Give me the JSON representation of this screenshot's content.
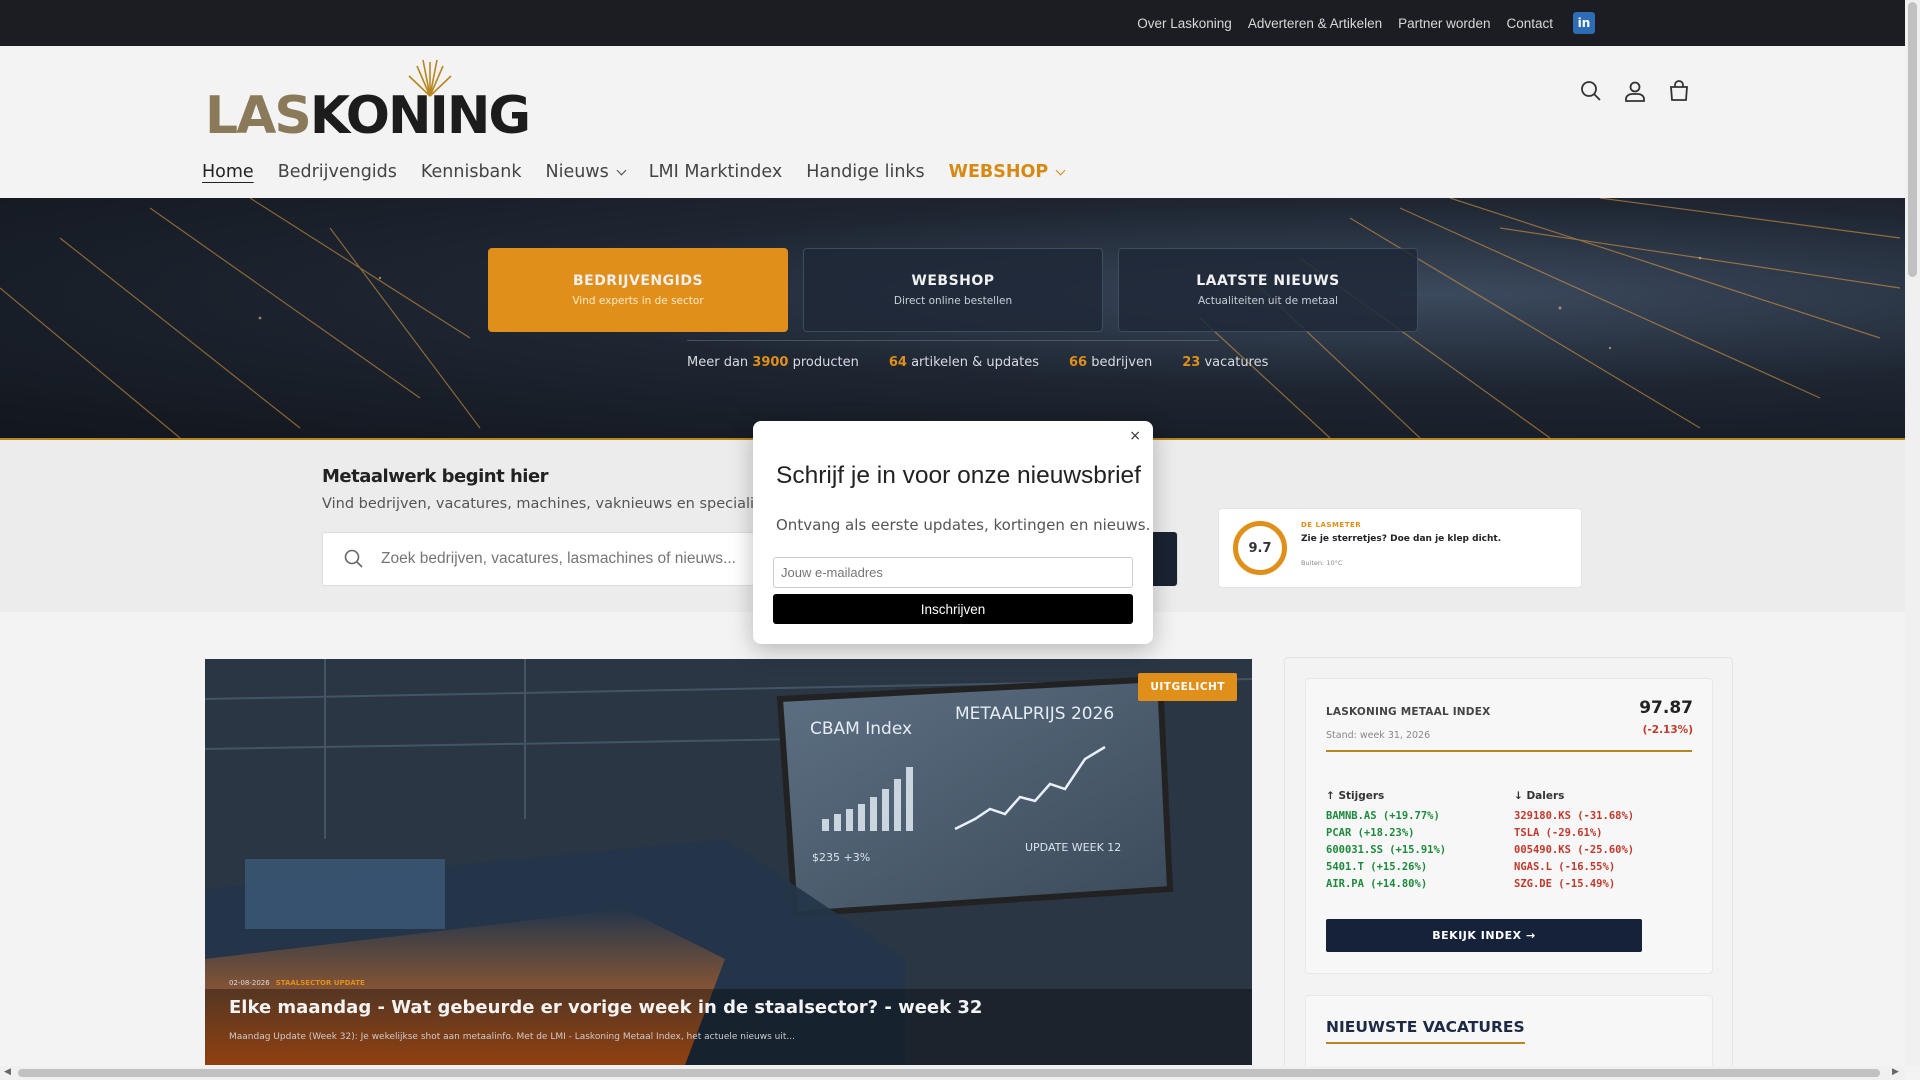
{
  "topnav": {
    "links": [
      "Over Laskoning",
      "Adverteren & Artikelen",
      "Partner worden",
      "Contact"
    ],
    "linkedin_icon": "in"
  },
  "logo": {
    "part1": "LAS",
    "part2": "KONING"
  },
  "mainnav": {
    "items": [
      "Home",
      "Bedrijvengids",
      "Kennisbank",
      "Nieuws",
      "LMI Marktindex",
      "Handige links",
      "WEBSHOP"
    ]
  },
  "hero": {
    "cards": [
      {
        "title": "BEDRIJVENGIDS",
        "sub": "Vind experts in de sector"
      },
      {
        "title": "WEBSHOP",
        "sub": "Direct online bestellen"
      },
      {
        "title": "LAATSTE NIEUWS",
        "sub": "Actualiteiten uit de metaal"
      }
    ],
    "stats": [
      {
        "pre": "Meer dan ",
        "num": "3900",
        "post": " producten"
      },
      {
        "pre": "",
        "num": "64",
        "post": " artikelen & updates"
      },
      {
        "pre": "",
        "num": "66",
        "post": " bedrijven"
      },
      {
        "pre": "",
        "num": "23",
        "post": " vacatures"
      }
    ]
  },
  "search": {
    "title": "Metaalwerk begint hier",
    "subtitle": "Vind bedrijven, vacatures, machines, vaknieuws en specialisten",
    "placeholder": "Zoek bedrijven, vacatures, lasmachines of nieuws..."
  },
  "lasmeter": {
    "score": "9.7",
    "label": "DE LASMETER",
    "message": "Zie je sterretjes? Doe dan je klep dicht.",
    "temp": "Buiten: 10°C"
  },
  "feature": {
    "badge": "UITGELICHT",
    "date": "02-08-2026",
    "category": "STAALSECTOR UPDATE",
    "title": "Elke maandag - Wat gebeurde er vorige week in de staalsector? - week 32",
    "excerpt": "Maandag Update (Week 32): Je wekelijkse shot aan metaalinfo. Met de LMI - Laskoning Metaal Index, het actuele nieuws uit...",
    "screen_left_title": "CBAM Index",
    "screen_right_title": "METAALPRIJS 2026",
    "screen_value": "$235 +3%",
    "screen_week": "UPDATE WEEK 12"
  },
  "index": {
    "name": "LASKONING METAAL INDEX",
    "date": "Stand: week 31, 2026",
    "value": "97.87",
    "change": "(-2.13%)",
    "risers_title": "↑ Stijgers",
    "fallers_title": "↓ Dalers",
    "risers": [
      "BAMNB.AS (+19.77%)",
      "PCAR (+18.23%)",
      "600031.SS (+15.91%)",
      "5401.T (+15.26%)",
      "AIR.PA (+14.80%)"
    ],
    "fallers": [
      "329180.KS (-31.68%)",
      "TSLA (-29.61%)",
      "005490.KS (-25.60%)",
      "NGAS.L (-16.55%)",
      "SZG.DE (-15.49%)"
    ],
    "button": "BEKIJK INDEX →"
  },
  "vacancies": {
    "title": "NIEUWSTE VACATURES"
  },
  "modal": {
    "close": "×",
    "title": "Schrijf je in voor onze nieuwsbrief",
    "subtitle": "Ontvang als eerste updates, kortingen en nieuws.",
    "placeholder": "Jouw e-mailadres",
    "button": "Inschrijven"
  },
  "colors": {
    "accent": "#e0901a",
    "dark": "#1b1d22",
    "navy": "#16223a",
    "up": "#1e8a3c",
    "down": "#c0392b"
  }
}
